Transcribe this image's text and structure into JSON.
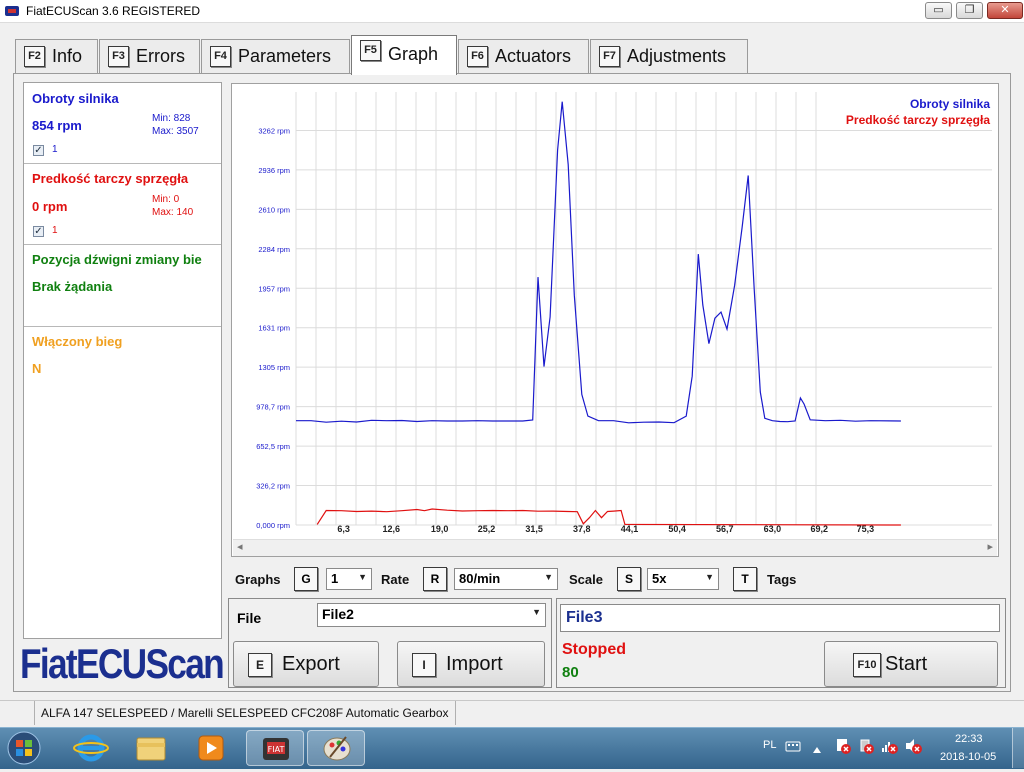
{
  "window": {
    "title": "FiatECUScan 3.6 REGISTERED",
    "controls": {
      "minimize": "▭",
      "maximize": "❐",
      "close": "✕"
    }
  },
  "tabs": [
    {
      "key": "F2",
      "label": "Info"
    },
    {
      "key": "F3",
      "label": "Errors"
    },
    {
      "key": "F4",
      "label": "Parameters"
    },
    {
      "key": "F5",
      "label": "Graph",
      "active": true
    },
    {
      "key": "F6",
      "label": "Actuators"
    },
    {
      "key": "F7",
      "label": "Adjustments"
    }
  ],
  "parameters": [
    {
      "name": "Obroty silnika",
      "value": "854 rpm",
      "min": "Min: 828",
      "max": "Max: 3507",
      "check": "✓",
      "index": "1",
      "color": "#1a1acc"
    },
    {
      "name": "Predkość tarczy sprzęgła",
      "value": "0 rpm",
      "min": "Min: 0",
      "max": "Max: 140",
      "check": "✓",
      "index": "1",
      "color": "#e01010"
    },
    {
      "name": "Pozycja dźwigni zmiany bie",
      "value": "Brak żądania",
      "color": "#108010"
    },
    {
      "name": "Włączony bieg",
      "value": "N",
      "color": "#f0a020"
    }
  ],
  "graph": {
    "legend": [
      {
        "name": "Obroty silnika",
        "color": "#1a1acc"
      },
      {
        "name": "Predkość tarczy sprzęgła",
        "color": "#e01010"
      }
    ],
    "scrollbar": {
      "left": "◂",
      "right": "▸"
    }
  },
  "chart_data": {
    "type": "line",
    "title": "",
    "xlabel": "",
    "ylabel": "",
    "xlim": [
      0,
      81
    ],
    "ylim": [
      0,
      3580
    ],
    "y_ticks": [
      {
        "v": 3262,
        "label": "3262 rpm"
      },
      {
        "v": 2936,
        "label": "2936 rpm"
      },
      {
        "v": 2610,
        "label": "2610 rpm"
      },
      {
        "v": 2284,
        "label": "2284 rpm"
      },
      {
        "v": 1957,
        "label": "1957 rpm"
      },
      {
        "v": 1631,
        "label": "1631 rpm"
      },
      {
        "v": 1305,
        "label": "1305 rpm"
      },
      {
        "v": 978.7,
        "label": "978,7 rpm"
      },
      {
        "v": 652.5,
        "label": "652,5 rpm"
      },
      {
        "v": 326.2,
        "label": "326,2 rpm"
      },
      {
        "v": 0,
        "label": "0,000 rpm"
      }
    ],
    "x_ticks": [
      {
        "v": 6.3,
        "label": "6,3"
      },
      {
        "v": 12.6,
        "label": "12,6"
      },
      {
        "v": 19.0,
        "label": "19,0"
      },
      {
        "v": 25.2,
        "label": "25,2"
      },
      {
        "v": 31.5,
        "label": "31,5"
      },
      {
        "v": 37.8,
        "label": "37,8"
      },
      {
        "v": 44.1,
        "label": "44,1"
      },
      {
        "v": 50.4,
        "label": "50,4"
      },
      {
        "v": 56.7,
        "label": "56,7"
      },
      {
        "v": 63.0,
        "label": "63,0"
      },
      {
        "v": 69.2,
        "label": "69,2"
      },
      {
        "v": 75.3,
        "label": "75,3"
      }
    ],
    "grid": true,
    "legend_position": "top-right",
    "series": [
      {
        "name": "Obroty silnika",
        "color": "#1a1acc",
        "points": [
          [
            0,
            862
          ],
          [
            2,
            862
          ],
          [
            4,
            850
          ],
          [
            6,
            858
          ],
          [
            8,
            852
          ],
          [
            10,
            866
          ],
          [
            12,
            862
          ],
          [
            14,
            864
          ],
          [
            16,
            856
          ],
          [
            18,
            862
          ],
          [
            20,
            860
          ],
          [
            22,
            860
          ],
          [
            24,
            862
          ],
          [
            26,
            860
          ],
          [
            28,
            860
          ],
          [
            30,
            860
          ],
          [
            31.3,
            868
          ],
          [
            32,
            2050
          ],
          [
            32.8,
            1310
          ],
          [
            33.6,
            1720
          ],
          [
            34.6,
            3100
          ],
          [
            35.2,
            3500
          ],
          [
            36,
            2980
          ],
          [
            36.8,
            1900
          ],
          [
            37.8,
            1080
          ],
          [
            38.6,
            900
          ],
          [
            40,
            862
          ],
          [
            42,
            862
          ],
          [
            44,
            845
          ],
          [
            46,
            850
          ],
          [
            48,
            852
          ],
          [
            50,
            846
          ],
          [
            51.6,
            900
          ],
          [
            52.4,
            1230
          ],
          [
            53.2,
            2240
          ],
          [
            53.8,
            1820
          ],
          [
            54.6,
            1500
          ],
          [
            55.4,
            1710
          ],
          [
            56.2,
            1760
          ],
          [
            57,
            1620
          ],
          [
            58,
            1980
          ],
          [
            59,
            2460
          ],
          [
            59.8,
            2890
          ],
          [
            60.6,
            1950
          ],
          [
            61.4,
            1100
          ],
          [
            62,
            882
          ],
          [
            63,
            862
          ],
          [
            64,
            856
          ],
          [
            65,
            854
          ],
          [
            66,
            860
          ],
          [
            66.7,
            1050
          ],
          [
            67.2,
            1000
          ],
          [
            68,
            870
          ],
          [
            70,
            862
          ],
          [
            72,
            866
          ],
          [
            74,
            858
          ],
          [
            76,
            862
          ],
          [
            80,
            860
          ]
        ]
      },
      {
        "name": "Predkość tarczy sprzęgła",
        "color": "#e01010",
        "points": [
          [
            2.8,
            5
          ],
          [
            4,
            120
          ],
          [
            6,
            118
          ],
          [
            8,
            112
          ],
          [
            10,
            115
          ],
          [
            12,
            110
          ],
          [
            14,
            118
          ],
          [
            16,
            128
          ],
          [
            17,
            118
          ],
          [
            18,
            132
          ],
          [
            20,
            122
          ],
          [
            22,
            116
          ],
          [
            24,
            118
          ],
          [
            26,
            120
          ],
          [
            28,
            118
          ],
          [
            30,
            120
          ],
          [
            32,
            114
          ],
          [
            34,
            115
          ],
          [
            36,
            112
          ],
          [
            37.2,
            110
          ],
          [
            38,
            10
          ],
          [
            38.8,
            60
          ],
          [
            39.6,
            120
          ],
          [
            40.4,
            60
          ],
          [
            41.2,
            112
          ],
          [
            42,
            115
          ],
          [
            43,
            120
          ],
          [
            43.5,
            5
          ],
          [
            80,
            0
          ]
        ]
      }
    ]
  },
  "controls": {
    "graphs": {
      "label": "Graphs",
      "key": "G",
      "value": "1"
    },
    "rate": {
      "label": "Rate",
      "key": "R",
      "value": "80/min"
    },
    "scale": {
      "label": "Scale",
      "key": "S",
      "value": "5x"
    },
    "tags": {
      "label": "Tags",
      "key": "T"
    },
    "arrow": "▼"
  },
  "file_box": {
    "label": "File",
    "selected": "File2",
    "export": {
      "key": "E",
      "label": "Export"
    },
    "import": {
      "key": "I",
      "label": "Import"
    }
  },
  "record_box": {
    "filename": "File3",
    "status": "Stopped",
    "count": "80",
    "start": {
      "key": "F10",
      "label": "Start"
    }
  },
  "logo": "FiatECUScan",
  "statusbar": {
    "text": "ALFA 147 SELESPEED / Marelli SELESPEED CFC208F Automatic Gearbox"
  },
  "taskbar": {
    "language": "PL",
    "time": "22:33",
    "date": "2018-10-05"
  }
}
